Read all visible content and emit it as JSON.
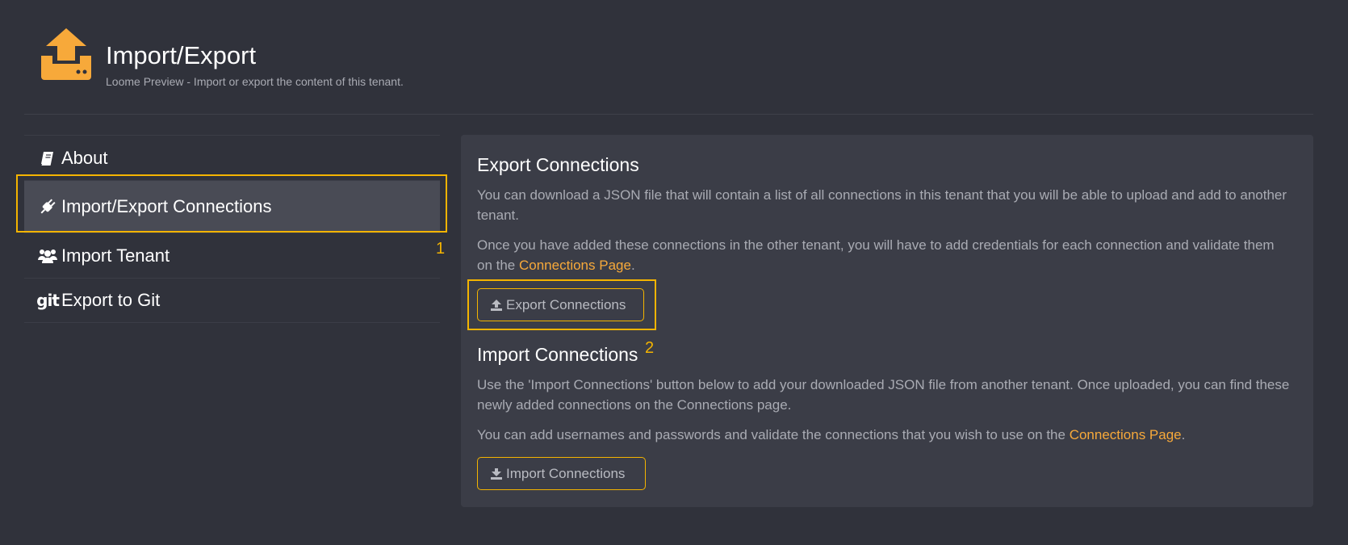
{
  "header": {
    "title": "Import/Export",
    "subtitle": "Loome Preview - Import or export the content of this tenant.",
    "icon": "upload-tray-icon",
    "accent_color": "#f7a93a"
  },
  "sidebar": {
    "items": [
      {
        "label": "About",
        "icon": "book-icon",
        "active": false
      },
      {
        "label": "Import/Export Connections",
        "icon": "plug-icon",
        "active": true
      },
      {
        "label": "Import Tenant",
        "icon": "users-icon",
        "active": false
      },
      {
        "label": "Export to Git",
        "icon": "git-icon",
        "glyph": "git",
        "active": false
      }
    ],
    "annotation": "1"
  },
  "content": {
    "export": {
      "title": "Export Connections",
      "paragraph1": "You can download a JSON file that will contain a list of all connections in this tenant that you will be able to upload and add to another tenant.",
      "paragraph2_prefix": "Once you have added these connections in the other tenant, you will have to add credentials for each connection and validate them on the ",
      "paragraph2_link": "Connections Page",
      "paragraph2_suffix": ".",
      "button_label": "Export Connections"
    },
    "import": {
      "title": "Import Connections",
      "annotation": "2",
      "paragraph1": "Use the 'Import Connections' button below to add your downloaded JSON file from another tenant. Once uploaded, you can find these newly added connections on the Connections page.",
      "paragraph2_prefix": "You can add usernames and passwords and validate the connections that you wish to use on the ",
      "paragraph2_link": "Connections Page",
      "paragraph2_suffix": ".",
      "button_label": "Import Connections"
    }
  },
  "colors": {
    "background": "#30323b",
    "card": "#3b3d47",
    "active_item": "#494b55",
    "highlight": "#f4b400",
    "link": "#f7a93a"
  }
}
